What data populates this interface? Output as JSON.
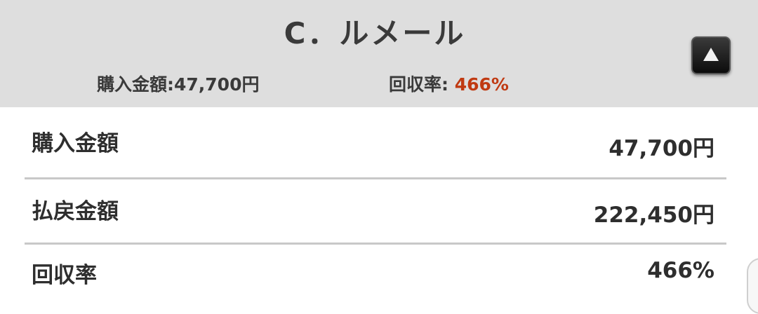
{
  "header": {
    "jockey_name": "C．ルメール",
    "summary": {
      "purchase_label": "購入金額:",
      "purchase_value": "47,700円",
      "rate_label": "回収率: ",
      "rate_value": "466%"
    },
    "toggle_icon": "triangle-up-icon"
  },
  "details": {
    "rows": [
      {
        "label": "購入金額",
        "value": "47,700円"
      },
      {
        "label": "払戻金額",
        "value": "222,450円"
      },
      {
        "label": "回収率",
        "value": "466%"
      }
    ]
  },
  "colors": {
    "accent": "#c03a12",
    "header_bg": "#dedede",
    "divider": "#c8c8c8"
  }
}
